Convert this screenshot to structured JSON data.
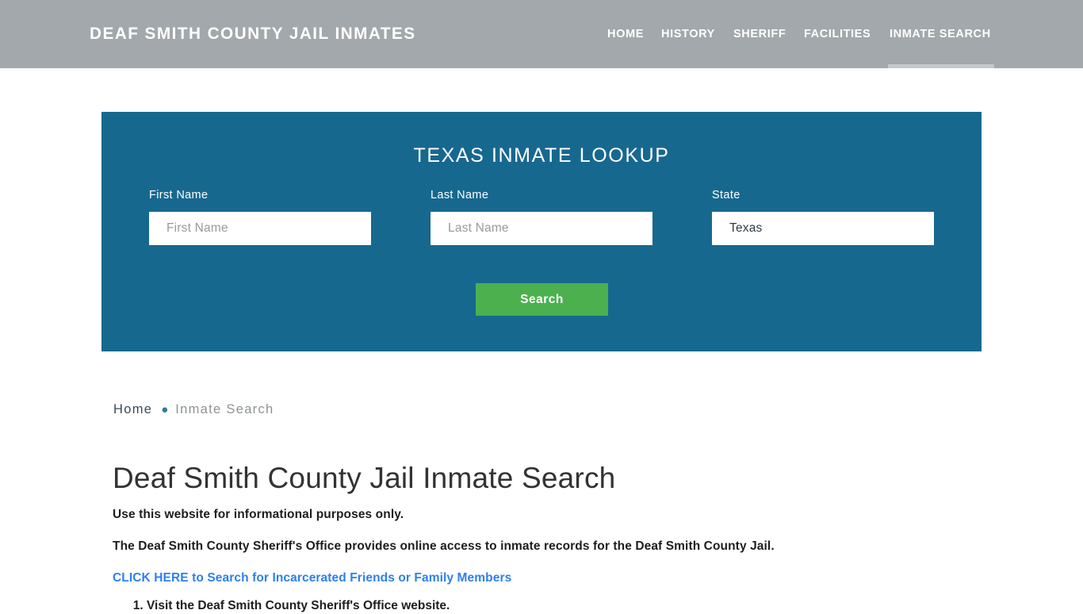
{
  "header": {
    "site_title": "Deaf Smith County Jail Inmates",
    "background_color": "#a2a8ab",
    "nav": [
      {
        "label": "Home",
        "active": false
      },
      {
        "label": "History",
        "active": false
      },
      {
        "label": "Sheriff",
        "active": false
      },
      {
        "label": "Facilities",
        "active": false
      },
      {
        "label": "Inmate Search",
        "active": true
      }
    ]
  },
  "search_panel": {
    "title": "Texas Inmate Lookup",
    "background_color": "#17688f",
    "fields": [
      {
        "label": "First Name",
        "value": "",
        "placeholder": "First Name"
      },
      {
        "label": "Last Name",
        "value": "",
        "placeholder": "Last Name"
      },
      {
        "label": "State",
        "value": "Texas",
        "placeholder": "State"
      }
    ],
    "submit_label": "Search",
    "submit_color": "#4cb04f"
  },
  "breadcrumb": {
    "home_label": "Home",
    "separator": "●",
    "current_label": "Inmate Search",
    "separator_color": "#2b7c96"
  },
  "main": {
    "title": "Deaf Smith County Jail Inmate Search",
    "paragraph_1": "Use this website for informational purposes only.",
    "paragraph_2": "The Deaf Smith County Sheriff's Office provides online access to inmate records for the Deaf Smith County Jail.",
    "link_text": "CLICK HERE to Search for Incarcerated Friends or Family Members",
    "link_color": "#2d7ff0",
    "steps": [
      "Visit the Deaf Smith County Sheriff's Office website."
    ]
  }
}
